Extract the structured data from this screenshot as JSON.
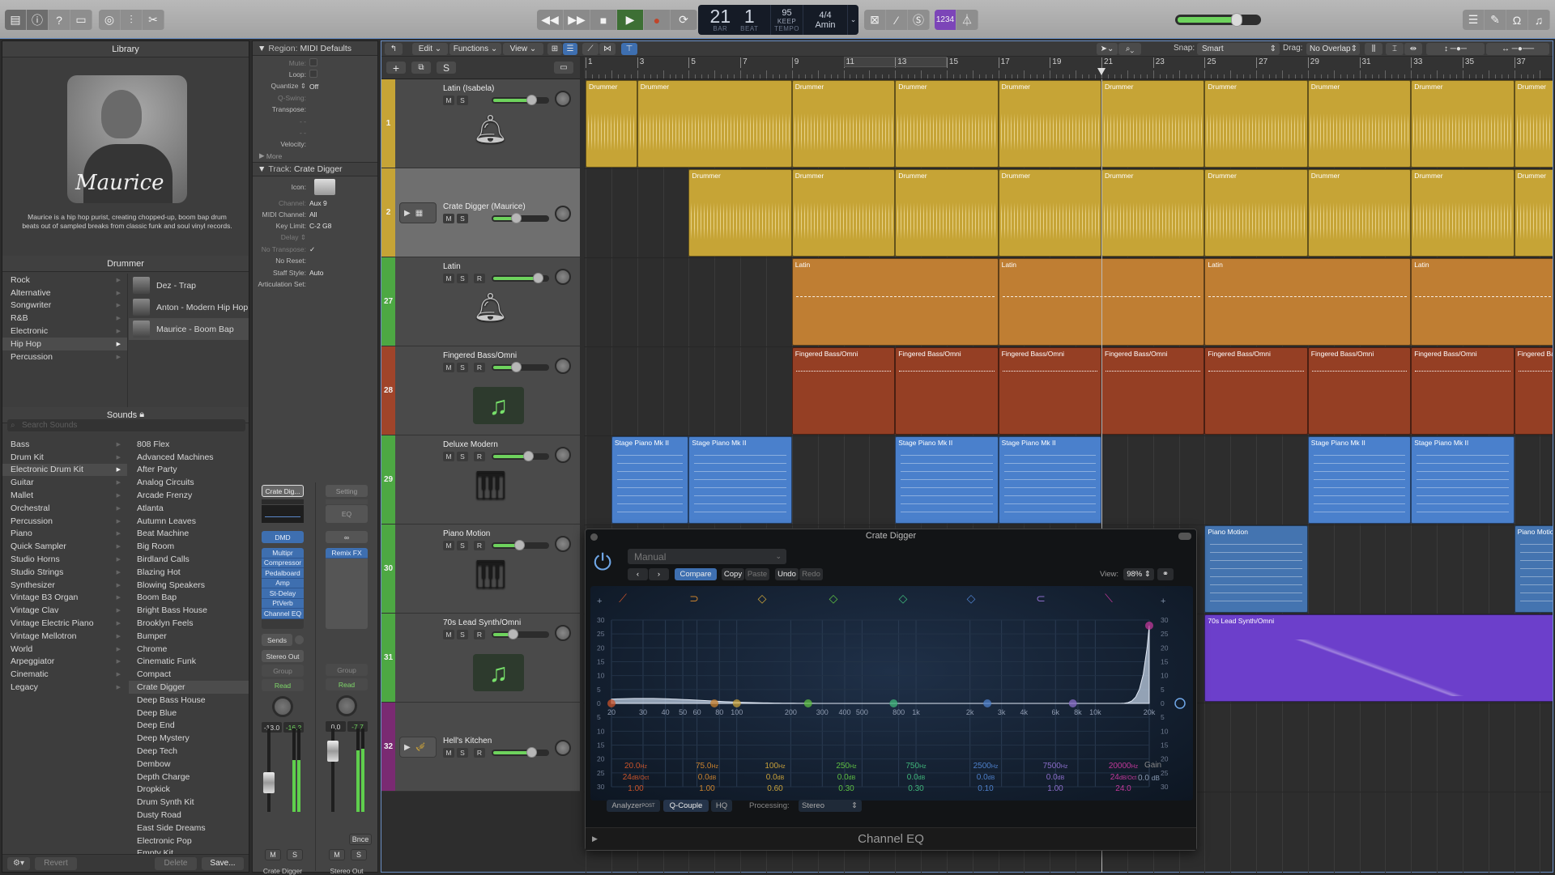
{
  "toolbar": {
    "left_icons": [
      "library-icon",
      "inspector-icon",
      "help-icon",
      "toolbar-icon",
      "smart-controls-icon",
      "mixer-icon",
      "editors-icon"
    ],
    "transport": [
      "rewind-icon",
      "fast-forward-icon",
      "stop-icon",
      "play-icon",
      "record-icon",
      "cycle-icon"
    ],
    "lcd": {
      "bar": "21",
      "bar_label": "BAR",
      "beat": "1",
      "beat_label": "BEAT",
      "tempo": "95",
      "tempo_mode": "KEEP",
      "tempo_label": "TEMPO",
      "signature": "4/4",
      "key": "Amin"
    },
    "right_modes": [
      "replace-icon",
      "tuner-icon",
      "solo-icon"
    ],
    "count_in": "1234",
    "metronome": "metronome-icon",
    "master_volume": 0.75,
    "right_icons": [
      "list-editors-icon",
      "notepad-icon",
      "loops-icon",
      "browser-icon"
    ]
  },
  "library": {
    "title": "Library",
    "portrait_name": "Maurice",
    "description": "Maurice is a hip hop purist, creating chopped-up, boom bap drum beats out of sampled breaks from classic funk and soul vinyl records.",
    "drummer_header": "Drummer",
    "genres": [
      "Rock",
      "Alternative",
      "Songwriter",
      "R&B",
      "Electronic",
      "Hip Hop",
      "Percussion"
    ],
    "selected_genre": "Hip Hop",
    "drummers": [
      "Dez - Trap",
      "Anton - Modern Hip Hop",
      "Maurice - Boom Bap"
    ],
    "selected_drummer": "Maurice - Boom Bap",
    "sounds_header": "Sounds",
    "search_placeholder": "Search Sounds",
    "categories": [
      "Bass",
      "Drum Kit",
      "Electronic Drum Kit",
      "Guitar",
      "Mallet",
      "Orchestral",
      "Percussion",
      "Piano",
      "Quick Sampler",
      "Studio Horns",
      "Studio Strings",
      "Synthesizer",
      "Vintage B3 Organ",
      "Vintage Clav",
      "Vintage Electric Piano",
      "Vintage Mellotron",
      "World",
      "Arpeggiator",
      "Cinematic",
      "Legacy"
    ],
    "selected_category": "Electronic Drum Kit",
    "patches": [
      "808 Flex",
      "Advanced Machines",
      "After Party",
      "Analog Circuits",
      "Arcade Frenzy",
      "Atlanta",
      "Autumn Leaves",
      "Beat Machine",
      "Big Room",
      "Birdland Calls",
      "Blazing Hot",
      "Blowing Speakers",
      "Boom Bap",
      "Bright Bass House",
      "Brooklyn Feels",
      "Bumper",
      "Chrome",
      "Cinematic Funk",
      "Compact",
      "Crate Digger",
      "Deep Bass House",
      "Deep Blue",
      "Deep End",
      "Deep Mystery",
      "Deep Tech",
      "Dembow",
      "Depth Charge",
      "Dropkick",
      "Drum Synth Kit",
      "Dusty Road",
      "East Side Dreams",
      "Electronic Pop",
      "Empty Kit"
    ],
    "selected_patch": "Crate Digger",
    "footer": {
      "revert": "Revert",
      "delete": "Delete",
      "save": "Save..."
    }
  },
  "inspector": {
    "region_header": "Region:",
    "region_name": "MIDI Defaults",
    "region_rows": [
      {
        "label": "Mute:",
        "value": "",
        "dim": true,
        "check": true
      },
      {
        "label": "Loop:",
        "value": "",
        "dim": false,
        "check": true
      },
      {
        "label": "Quantize ⇕",
        "value": "Off",
        "dim": false
      },
      {
        "label": "Q-Swing:",
        "value": "",
        "dim": true
      },
      {
        "label": "Transpose:",
        "value": "",
        "dim": false
      },
      {
        "label": "- -",
        "value": "",
        "dim": true
      },
      {
        "label": "- -",
        "value": "",
        "dim": true
      },
      {
        "label": "Velocity:",
        "value": "",
        "dim": false
      }
    ],
    "more": "More",
    "track_header": "Track:",
    "track_name": "Crate Digger",
    "track_rows": [
      {
        "label": "Channel:",
        "value": "Aux 9",
        "dim": true
      },
      {
        "label": "MIDI Channel:",
        "value": "All",
        "dim": false
      },
      {
        "label": "Key Limit:",
        "value": "C-2  G8",
        "dim": false
      },
      {
        "label": "Delay ⇕",
        "value": "",
        "dim": true
      },
      {
        "label": "No Transpose:",
        "value": "✓",
        "dim": true
      },
      {
        "label": "No Reset:",
        "value": "",
        "dim": false
      },
      {
        "label": "Staff Style:",
        "value": "Auto",
        "dim": false
      },
      {
        "label": "Articulation Set:",
        "value": "",
        "dim": false
      }
    ],
    "icon_label": "Icon:",
    "strip1": {
      "setting": "Crate Dig...",
      "instrument": "DMD",
      "plugins": [
        "Multipr",
        "Compressor",
        "Pedalboard",
        "Amp",
        "St-Delay",
        "PtVerb",
        "Channel EQ"
      ],
      "sends": "Sends",
      "output": "Stereo Out",
      "group": "Group",
      "automation": "Read",
      "volume": "-13.0",
      "peak": "-16.2",
      "name": "Crate Digger",
      "mute": "M",
      "solo": "S"
    },
    "strip2": {
      "setting": "Setting",
      "eq": "EQ",
      "link": "∞",
      "plugins": [
        "Remix FX"
      ],
      "group": "Group",
      "automation": "Read",
      "volume": "0.0",
      "peak": "-7.7",
      "bounce": "Bnce",
      "name": "Stereo Out",
      "mute": "M",
      "solo": "S"
    }
  },
  "tracks_toolbar": {
    "edit": "Edit",
    "functions": "Functions",
    "view": "View",
    "snap_label": "Snap:",
    "snap_value": "Smart",
    "drag_label": "Drag:",
    "drag_value": "No Overlap"
  },
  "track_header_buttons": {
    "add": "+",
    "solo": "S"
  },
  "ruler": [
    "1",
    "3",
    "5",
    "7",
    "9",
    "11",
    "13",
    "15",
    "17",
    "19",
    "21",
    "23",
    "25",
    "27",
    "29",
    "31",
    "33",
    "35",
    "37"
  ],
  "playhead_bar": 21,
  "tracks": [
    {
      "num": "1",
      "name": "Latin (Isabela)",
      "color": "#c6a436",
      "buttons": [
        "M",
        "S"
      ],
      "volume": 0.72,
      "icon": "percussion-icon",
      "selected": false
    },
    {
      "num": "2",
      "name": "Crate Digger (Maurice)",
      "color": "#c6a436",
      "buttons": [
        "M",
        "S"
      ],
      "volume": 0.4,
      "icon": "drum-machine-icon",
      "selected": true
    },
    {
      "num": "27",
      "name": "Latin",
      "color": "#4da843",
      "buttons": [
        "M",
        "S",
        "R"
      ],
      "volume": 0.85,
      "icon": "percussion-icon",
      "selected": false
    },
    {
      "num": "28",
      "name": "Fingered Bass/Omni",
      "color": "#a0442a",
      "buttons": [
        "M",
        "S",
        "R"
      ],
      "volume": 0.4,
      "icon": "music-note-icon",
      "selected": false
    },
    {
      "num": "29",
      "name": "Deluxe Modern",
      "color": "#4da843",
      "buttons": [
        "M",
        "S",
        "R"
      ],
      "volume": 0.65,
      "icon": "electric-piano-icon",
      "selected": false
    },
    {
      "num": "30",
      "name": "Piano Motion",
      "color": "#4da843",
      "buttons": [
        "M",
        "S",
        "R"
      ],
      "volume": 0.47,
      "icon": "grand-piano-icon",
      "selected": false
    },
    {
      "num": "31",
      "name": "70s Lead Synth/Omni",
      "color": "#4da843",
      "buttons": [
        "M",
        "S",
        "R"
      ],
      "volume": 0.33,
      "icon": "music-note-icon",
      "selected": false
    },
    {
      "num": "32",
      "name": "Hell's Kitchen",
      "color": "#7a2a72",
      "buttons": [
        "M",
        "S",
        "R"
      ],
      "volume": 0.72,
      "icon": "horns-icon",
      "selected": false
    }
  ],
  "regions": [
    {
      "track": 0,
      "start": 1,
      "end": 3,
      "name": "Drummer",
      "color": "#c6a436"
    },
    {
      "track": 0,
      "start": 3,
      "end": 9,
      "name": "Drummer",
      "color": "#c6a436"
    },
    {
      "track": 0,
      "start": 9,
      "end": 13,
      "name": "Drummer",
      "color": "#c6a436"
    },
    {
      "track": 0,
      "start": 13,
      "end": 17,
      "name": "Drummer",
      "color": "#c6a436"
    },
    {
      "track": 0,
      "start": 17,
      "end": 21,
      "name": "Drummer",
      "color": "#c6a436"
    },
    {
      "track": 0,
      "start": 21,
      "end": 25,
      "name": "Drummer",
      "color": "#c6a436"
    },
    {
      "track": 0,
      "start": 25,
      "end": 29,
      "name": "Drummer",
      "color": "#c6a436"
    },
    {
      "track": 0,
      "start": 29,
      "end": 33,
      "name": "Drummer",
      "color": "#c6a436"
    },
    {
      "track": 0,
      "start": 33,
      "end": 37,
      "name": "Drummer",
      "color": "#c6a436"
    },
    {
      "track": 0,
      "start": 37,
      "end": 40,
      "name": "Drummer",
      "color": "#c6a436"
    },
    {
      "track": 1,
      "start": 5,
      "end": 9,
      "name": "Drummer",
      "color": "#c6a436"
    },
    {
      "track": 1,
      "start": 9,
      "end": 13,
      "name": "Drummer",
      "color": "#c6a436"
    },
    {
      "track": 1,
      "start": 13,
      "end": 17,
      "name": "Drummer",
      "color": "#c6a436"
    },
    {
      "track": 1,
      "start": 17,
      "end": 21,
      "name": "Drummer",
      "color": "#c6a436"
    },
    {
      "track": 1,
      "start": 21,
      "end": 25,
      "name": "Drummer",
      "color": "#c6a436"
    },
    {
      "track": 1,
      "start": 25,
      "end": 29,
      "name": "Drummer",
      "color": "#c6a436"
    },
    {
      "track": 1,
      "start": 29,
      "end": 33,
      "name": "Drummer",
      "color": "#c6a436"
    },
    {
      "track": 1,
      "start": 33,
      "end": 37,
      "name": "Drummer",
      "color": "#c6a436"
    },
    {
      "track": 1,
      "start": 37,
      "end": 40,
      "name": "Drummer",
      "color": "#c6a436"
    },
    {
      "track": 2,
      "start": 9,
      "end": 17,
      "name": "Latin",
      "color": "#bf7e33"
    },
    {
      "track": 2,
      "start": 17,
      "end": 25,
      "name": "Latin",
      "color": "#bf7e33"
    },
    {
      "track": 2,
      "start": 25,
      "end": 33,
      "name": "Latin",
      "color": "#bf7e33"
    },
    {
      "track": 2,
      "start": 33,
      "end": 40,
      "name": "Latin",
      "color": "#bf7e33"
    },
    {
      "track": 3,
      "start": 9,
      "end": 13,
      "name": "Fingered Bass/Omni",
      "color": "#953f24"
    },
    {
      "track": 3,
      "start": 13,
      "end": 17,
      "name": "Fingered Bass/Omni",
      "color": "#953f24"
    },
    {
      "track": 3,
      "start": 17,
      "end": 21,
      "name": "Fingered Bass/Omni",
      "color": "#953f24"
    },
    {
      "track": 3,
      "start": 21,
      "end": 25,
      "name": "Fingered Bass/Omni",
      "color": "#953f24"
    },
    {
      "track": 3,
      "start": 25,
      "end": 29,
      "name": "Fingered Bass/Omni",
      "color": "#953f24"
    },
    {
      "track": 3,
      "start": 29,
      "end": 33,
      "name": "Fingered Bass/Omni",
      "color": "#953f24"
    },
    {
      "track": 3,
      "start": 33,
      "end": 37,
      "name": "Fingered Bass/Omni",
      "color": "#953f24"
    },
    {
      "track": 3,
      "start": 37,
      "end": 40,
      "name": "Fingered Bass/Omni",
      "color": "#953f24"
    },
    {
      "track": 4,
      "start": 2,
      "end": 5,
      "name": "Stage Piano Mk II",
      "color": "#4a80cc"
    },
    {
      "track": 4,
      "start": 5,
      "end": 9,
      "name": "Stage Piano Mk II",
      "color": "#4a80cc"
    },
    {
      "track": 4,
      "start": 13,
      "end": 17,
      "name": "Stage Piano Mk II",
      "color": "#4a80cc"
    },
    {
      "track": 4,
      "start": 17,
      "end": 21,
      "name": "Stage Piano Mk II",
      "color": "#4a80cc"
    },
    {
      "track": 4,
      "start": 29,
      "end": 33,
      "name": "Stage Piano Mk II",
      "color": "#4a80cc"
    },
    {
      "track": 4,
      "start": 33,
      "end": 37,
      "name": "Stage Piano Mk II",
      "color": "#4a80cc"
    },
    {
      "track": 5,
      "start": 25,
      "end": 29,
      "name": "Piano Motion",
      "color": "#4474b0"
    },
    {
      "track": 5,
      "start": 37,
      "end": 40,
      "name": "Piano Motion",
      "color": "#4474b0"
    },
    {
      "track": 6,
      "start": 25,
      "end": 40,
      "name": "70s Lead Synth/Omni",
      "color": "#6c3fcb"
    }
  ],
  "eq": {
    "title": "Crate Digger",
    "preset": "Manual",
    "compare": "Compare",
    "copy": "Copy",
    "paste": "Paste",
    "undo": "Undo",
    "redo": "Redo",
    "view_label": "View:",
    "view_value": "98%",
    "footer_title": "Channel EQ",
    "analyzer": "Analyzer",
    "analyzer_sup": "POST",
    "q_couple": "Q-Couple",
    "hq": "HQ",
    "processing_label": "Processing:",
    "processing_value": "Stereo",
    "gain_label": "Gain",
    "gain_value": "0.0",
    "gain_unit": "dB",
    "bands": [
      {
        "freq": "20.0",
        "unit": "Hz",
        "gain": "24",
        "gain_unit": "dB/Oct",
        "q": "1.00",
        "color": "#c9532a",
        "icon": "low-cut-icon"
      },
      {
        "freq": "75.0",
        "unit": "Hz",
        "gain": "0.0",
        "gain_unit": "dB",
        "q": "1.00",
        "color": "#c9822e",
        "icon": "low-shelf-icon"
      },
      {
        "freq": "100",
        "unit": "Hz",
        "gain": "0.0",
        "gain_unit": "dB",
        "q": "0.60",
        "color": "#c7a03a",
        "icon": "bell-icon"
      },
      {
        "freq": "250",
        "unit": "Hz",
        "gain": "0.0",
        "gain_unit": "dB",
        "q": "0.30",
        "color": "#5dbf43",
        "icon": "bell-icon"
      },
      {
        "freq": "750",
        "unit": "Hz",
        "gain": "0.0",
        "gain_unit": "dB",
        "q": "0.30",
        "color": "#3fb57a",
        "icon": "bell-icon"
      },
      {
        "freq": "2500",
        "unit": "Hz",
        "gain": "0.0",
        "gain_unit": "dB",
        "q": "0.10",
        "color": "#4d7fc9",
        "icon": "bell-icon"
      },
      {
        "freq": "7500",
        "unit": "Hz",
        "gain": "0.0",
        "gain_unit": "dB",
        "q": "1.00",
        "color": "#8a6dc9",
        "icon": "high-shelf-icon"
      },
      {
        "freq": "20000",
        "unit": "Hz",
        "gain": "24",
        "gain_unit": "dB/Oct",
        "q": "24.0",
        "color": "#c0389a",
        "icon": "high-cut-icon"
      }
    ],
    "freq_ticks": [
      "20",
      "30",
      "40",
      "50",
      "60",
      "80",
      "100",
      "200",
      "300",
      "400",
      "500",
      "800",
      "1k",
      "2k",
      "3k",
      "4k",
      "6k",
      "8k",
      "10k",
      "20k"
    ],
    "db_ticks": [
      "30",
      "25",
      "20",
      "15",
      "10",
      "5",
      "0",
      "5",
      "10",
      "15",
      "20",
      "25",
      "30"
    ]
  }
}
